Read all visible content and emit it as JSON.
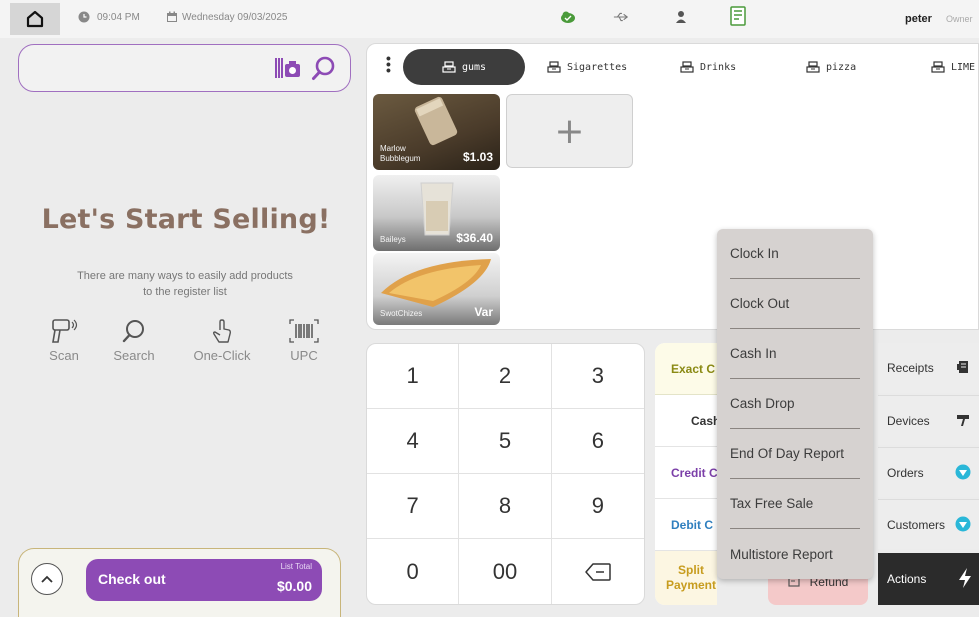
{
  "topbar": {
    "time": "09:04 PM",
    "date": "Wednesday 09/03/2025",
    "user": "peter",
    "role": "Owner"
  },
  "left": {
    "search_value": "",
    "headline": "Let's Start Selling!",
    "subtext_line1": "There are many ways to easily add products",
    "subtext_line2": "to the register list",
    "methods": [
      {
        "label": "Scan",
        "icon": "scanner-icon"
      },
      {
        "label": "Search",
        "icon": "magnifier-icon"
      },
      {
        "label": "One-Click",
        "icon": "tap-hand-icon"
      },
      {
        "label": "UPC",
        "icon": "barcode-icon"
      }
    ],
    "checkout": {
      "label": "Check out",
      "list_total_label": "List Total",
      "total": "$0.00"
    }
  },
  "categories": [
    {
      "label": "gums",
      "active": true
    },
    {
      "label": "Sigarettes",
      "active": false
    },
    {
      "label": "Drinks",
      "active": false
    },
    {
      "label": "pizza",
      "active": false
    },
    {
      "label": "LIME",
      "active": false
    }
  ],
  "products": [
    {
      "name_line1": "Marlow",
      "name_line2": "Bubblegum",
      "price": "$1.03"
    },
    {
      "name_line1": "",
      "name_line2": "Baileys",
      "price": "$36.40"
    },
    {
      "name_line1": "",
      "name_line2": "SwotChizes",
      "price": "Var"
    }
  ],
  "add_product_symbol": "+",
  "keypad": [
    "1",
    "2",
    "3",
    "4",
    "5",
    "6",
    "7",
    "8",
    "9",
    "0",
    "00",
    "⌫"
  ],
  "payments": [
    {
      "label": "Exact C",
      "color": "#8a8a14",
      "bg": "#fdfbe8"
    },
    {
      "label": "Cash",
      "color": "#333333",
      "bg": "#ffffff"
    },
    {
      "label": "Credit C",
      "color": "#7b3fa8",
      "bg": "#ffffff"
    },
    {
      "label": "Debit C",
      "color": "#2f7fbf",
      "bg": "#ffffff"
    },
    {
      "label": "Split Payment",
      "color": "#c79c1e",
      "bg": "#fcf6e2"
    }
  ],
  "refund_label": "Refund",
  "side_menu": [
    {
      "label": "Receipts",
      "icon": "receipt-icon"
    },
    {
      "label": "Devices",
      "icon": "devices-icon"
    },
    {
      "label": "Orders",
      "icon": "orders-badge-icon"
    },
    {
      "label": "Customers",
      "icon": "customers-badge-icon"
    }
  ],
  "actions_label": "Actions",
  "actions_menu": [
    "Clock In",
    "Clock Out",
    "Cash In",
    "Cash Drop",
    "End Of Day Report",
    "Tax Free Sale",
    "Multistore Report"
  ],
  "colors": {
    "accent_purple": "#8d4bb5",
    "headline_brown": "#8a7062",
    "badge_cyan": "#2ab7d8"
  }
}
